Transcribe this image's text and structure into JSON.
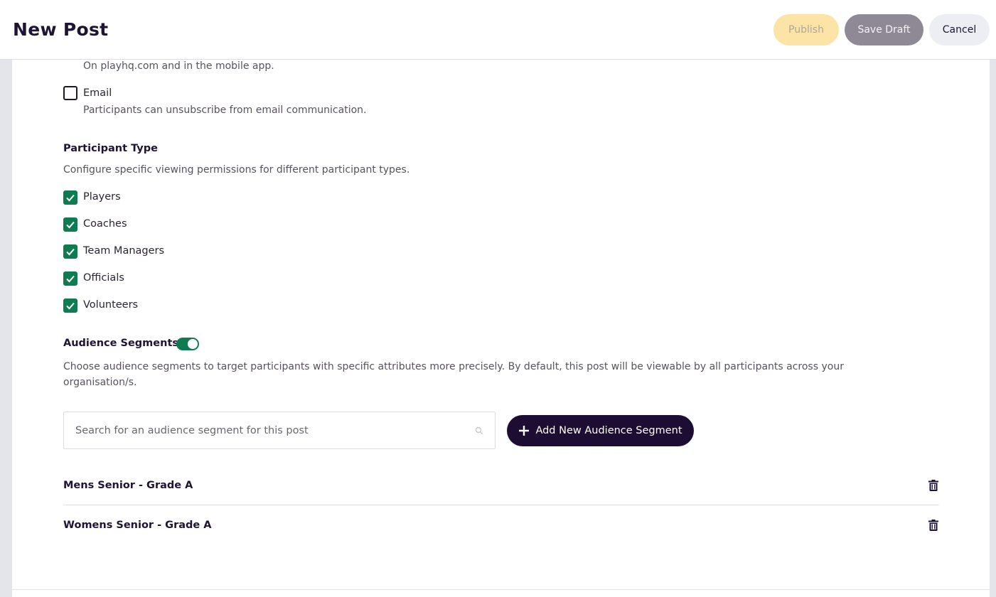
{
  "header": {
    "title": "New Post",
    "publish_label": "Publish",
    "save_draft_label": "Save Draft",
    "cancel_label": "Cancel"
  },
  "channels": {
    "web_description": "On playhq.com and in the mobile app.",
    "email": {
      "label": "Email",
      "checked": false,
      "description": "Participants can unsubscribe from email communication."
    }
  },
  "participant_type": {
    "heading": "Participant Type",
    "description": "Configure specific viewing permissions for different participant types.",
    "options": [
      {
        "label": "Players",
        "checked": true
      },
      {
        "label": "Coaches",
        "checked": true
      },
      {
        "label": "Team Managers",
        "checked": true
      },
      {
        "label": "Officials",
        "checked": true
      },
      {
        "label": "Volunteers",
        "checked": true
      }
    ]
  },
  "audience_segments": {
    "heading": "Audience Segments",
    "enabled": true,
    "description": "Choose audience segments to target participants with specific attributes more precisely. By default, this post will be viewable by all participants across your organisation/s.",
    "search_placeholder": "Search for an audience segment for this post",
    "add_label": "Add New Audience Segment",
    "segments": [
      {
        "name": "Mens Senior - Grade A"
      },
      {
        "name": "Womens Senior - Grade A"
      }
    ]
  },
  "colors": {
    "accent_green": "#0e7c50",
    "primary_dark": "#1e0d33",
    "publish_bg": "#fbe4a6",
    "draft_bg": "#8f8895"
  },
  "icons": {
    "check": "check-icon",
    "search": "search-icon",
    "plus": "plus-icon",
    "trash": "trash-icon"
  }
}
